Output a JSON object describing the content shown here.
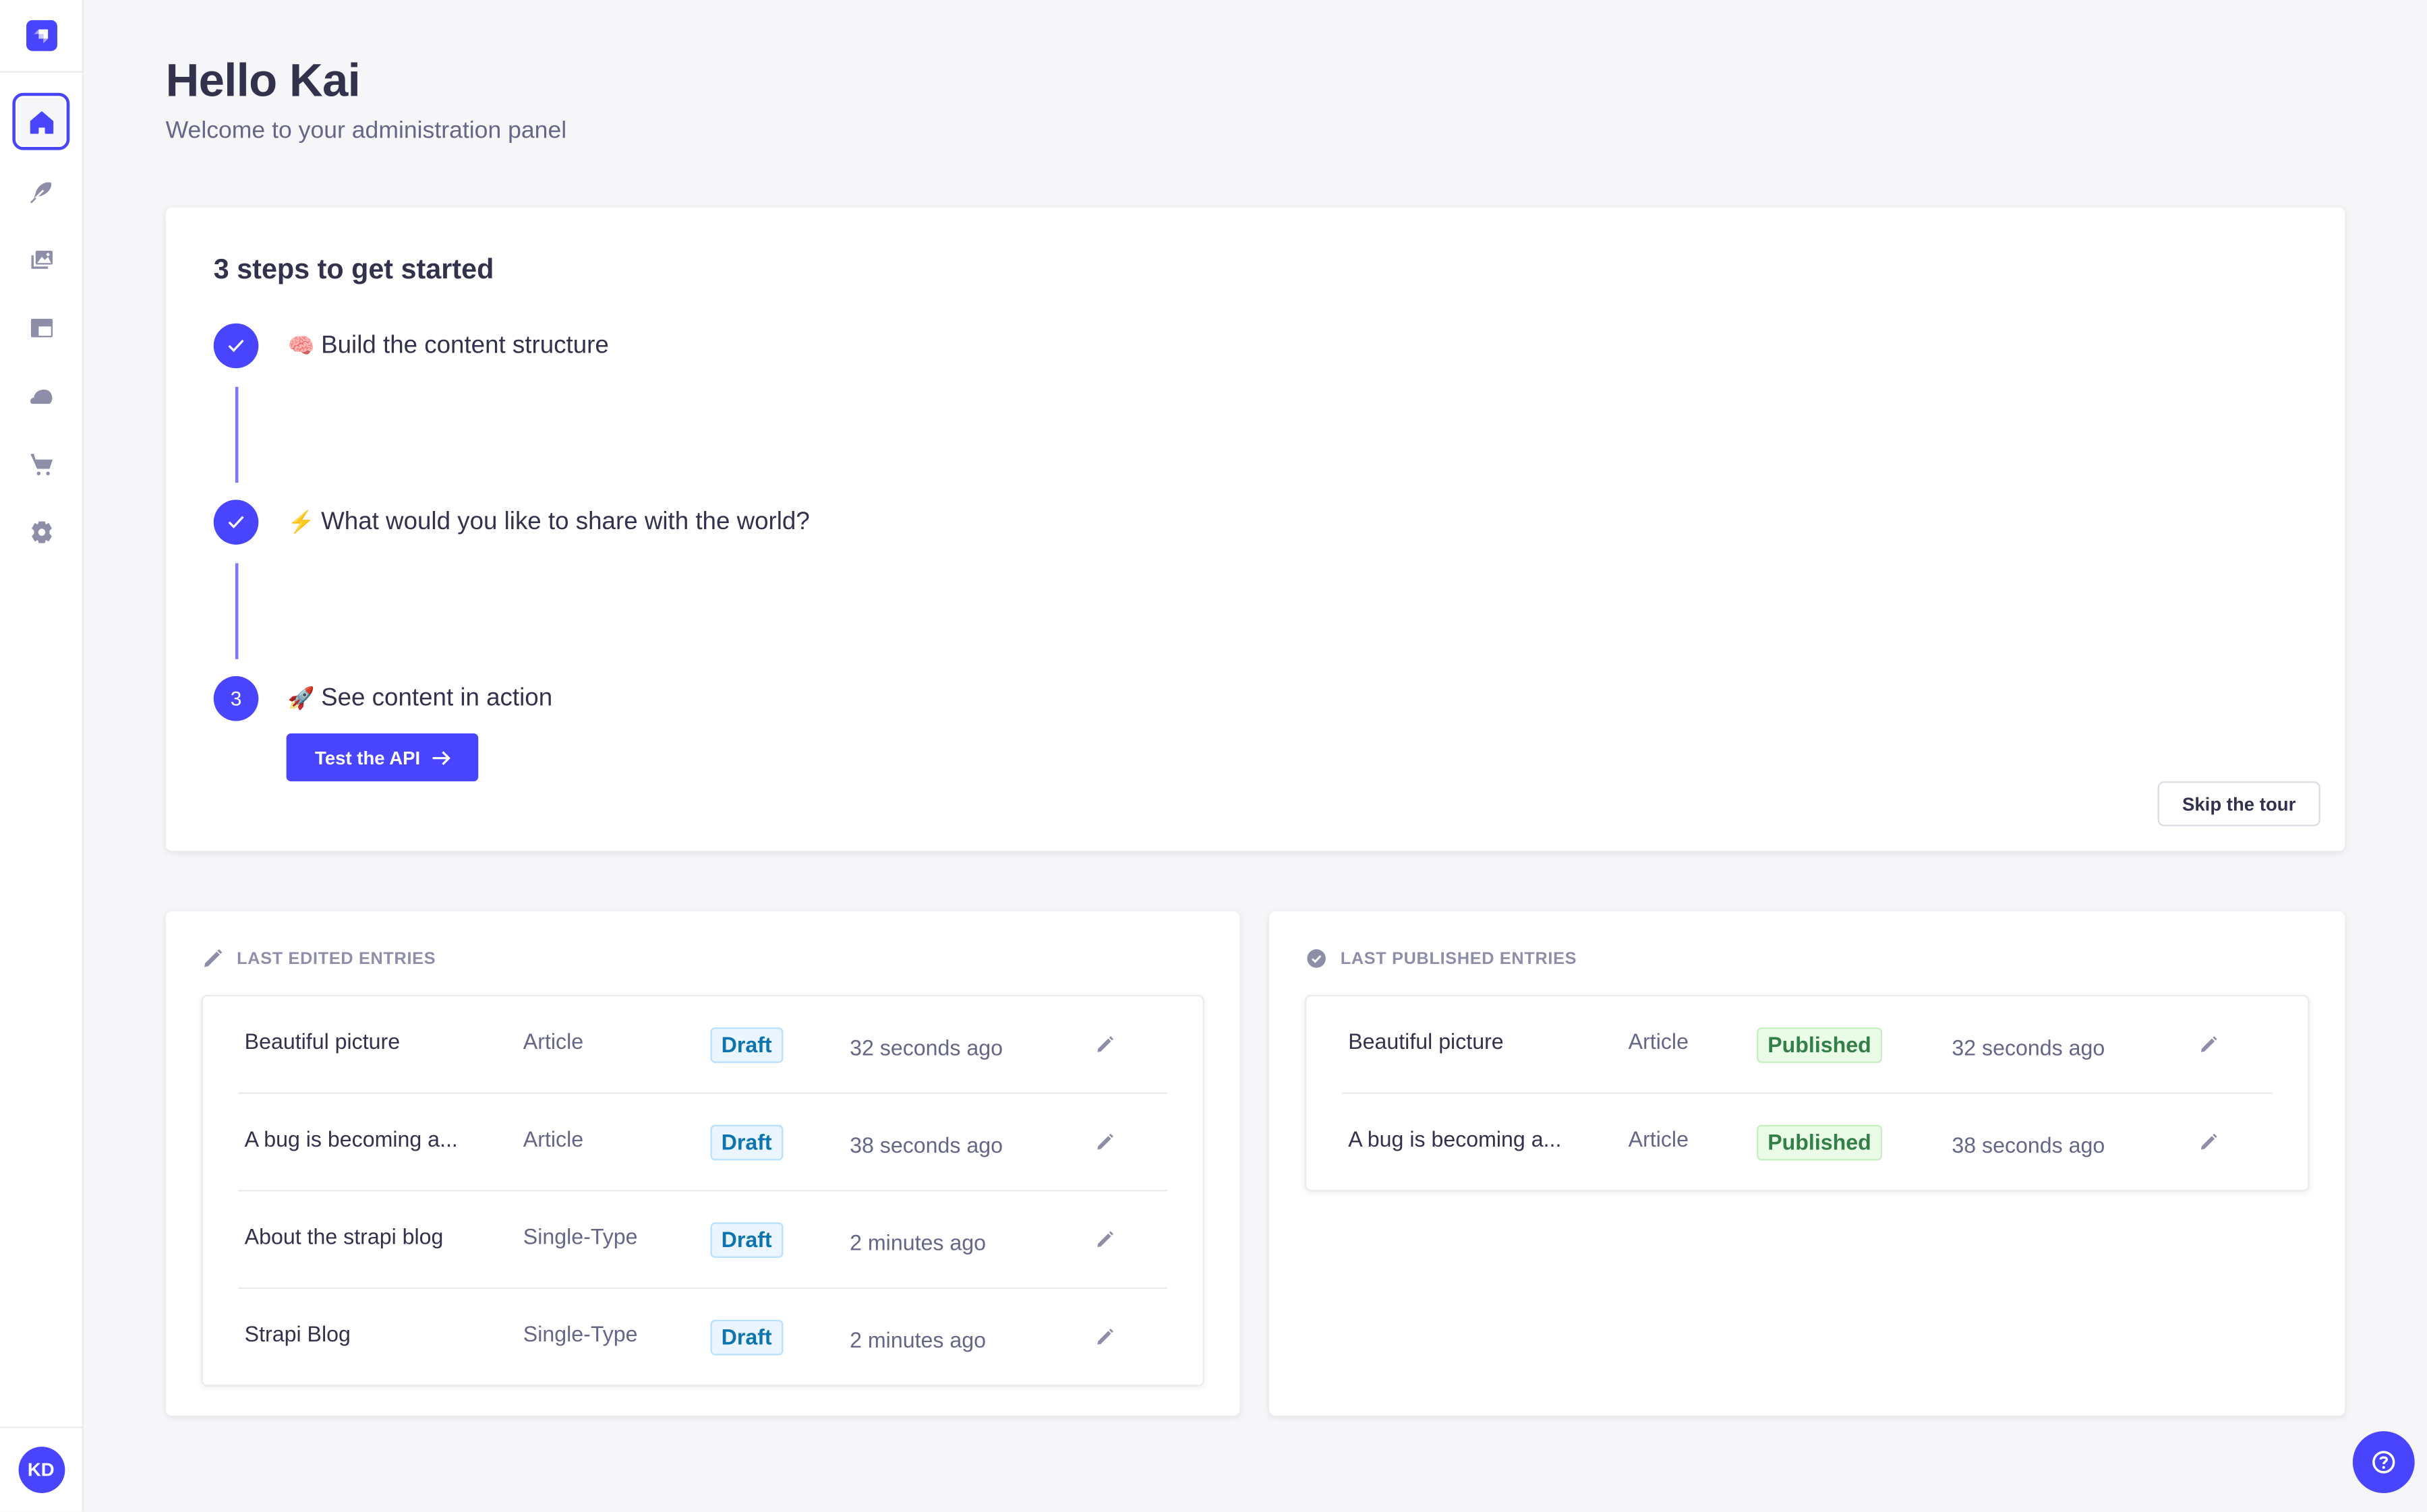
{
  "sidebar": {
    "logo": "strapi-logo-icon",
    "items": [
      {
        "id": "home",
        "icon": "home-icon",
        "active": true
      },
      {
        "id": "content-manager",
        "icon": "feather-icon",
        "active": false
      },
      {
        "id": "media-library",
        "icon": "images-icon",
        "active": false
      },
      {
        "id": "content-type-builder",
        "icon": "layout-icon",
        "active": false
      },
      {
        "id": "plugins",
        "icon": "cloud-icon",
        "active": false
      },
      {
        "id": "marketplace",
        "icon": "cart-icon",
        "active": false
      },
      {
        "id": "settings",
        "icon": "gear-icon",
        "active": false
      }
    ],
    "user_initials": "KD"
  },
  "header": {
    "title": "Hello Kai",
    "subtitle": "Welcome to your administration panel"
  },
  "onboarding": {
    "title": "3 steps to get started",
    "steps": [
      {
        "status": "done",
        "marker": "",
        "emoji": "🧠",
        "label": "Build the content structure"
      },
      {
        "status": "done",
        "marker": "",
        "emoji": "⚡",
        "label": "What would you like to share with the world?"
      },
      {
        "status": "current",
        "marker": "3",
        "emoji": "🚀",
        "label": "See content in action"
      }
    ],
    "primary_button": "Test the API",
    "skip_button": "Skip the tour"
  },
  "last_edited": {
    "title": "LAST EDITED ENTRIES",
    "rows": [
      {
        "title": "Beautiful picture",
        "type": "Article",
        "status": "Draft",
        "time": "32 seconds ago"
      },
      {
        "title": "A bug is becoming a...",
        "type": "Article",
        "status": "Draft",
        "time": "38 seconds ago"
      },
      {
        "title": "About the strapi blog",
        "type": "Single-Type",
        "status": "Draft",
        "time": "2 minutes ago"
      },
      {
        "title": "Strapi Blog",
        "type": "Single-Type",
        "status": "Draft",
        "time": "2 minutes ago"
      }
    ]
  },
  "last_published": {
    "title": "LAST PUBLISHED ENTRIES",
    "rows": [
      {
        "title": "Beautiful picture",
        "type": "Article",
        "status": "Published",
        "time": "32 seconds ago"
      },
      {
        "title": "A bug is becoming a...",
        "type": "Article",
        "status": "Published",
        "time": "38 seconds ago"
      }
    ]
  },
  "colors": {
    "primary": "#4945ff",
    "text": "#32324d",
    "muted": "#666687",
    "draft_text": "#0c75af",
    "published_text": "#328048",
    "background": "#f6f6f9"
  },
  "help_button": "help-icon"
}
